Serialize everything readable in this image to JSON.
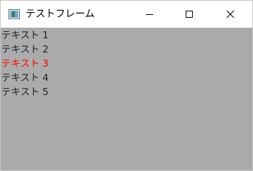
{
  "window": {
    "title": "テストフレーム",
    "app_icon": "java-frame-icon",
    "controls": {
      "minimize_icon": "minimize-icon",
      "maximize_icon": "maximize-icon",
      "close_icon": "close-icon"
    }
  },
  "content": {
    "background": "#ababab",
    "items": [
      {
        "label": "テキスト 1",
        "color": "#222222"
      },
      {
        "label": "テキスト 2",
        "color": "#222222"
      },
      {
        "label": "テキスト 3",
        "color": "#ff0000"
      },
      {
        "label": "テキスト 4",
        "color": "#222222"
      },
      {
        "label": "テキスト 5",
        "color": "#222222"
      }
    ]
  }
}
